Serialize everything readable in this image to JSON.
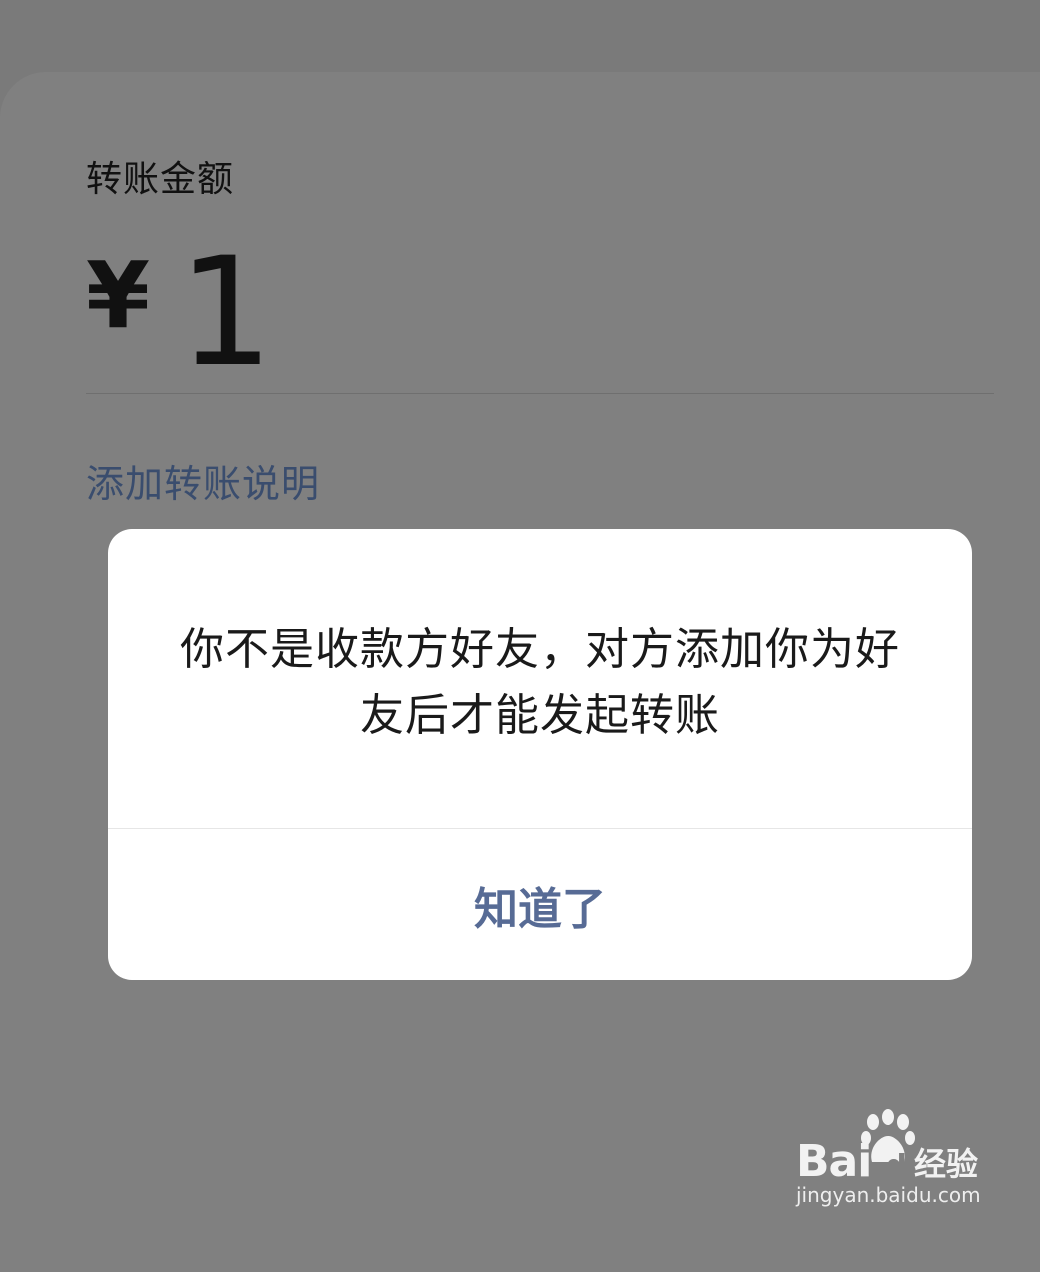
{
  "transfer": {
    "amount_label": "转账金额",
    "currency_symbol": "¥",
    "amount": "1",
    "add_note_link": "添加转账说明"
  },
  "dialog": {
    "message": "你不是收款方好友，对方添加你为好友后才能发起转账",
    "confirm_button": "知道了"
  },
  "watermark": {
    "brand": "Bai",
    "brand_suffix": "du",
    "label": "经验",
    "url": "jingyan.baidu.com"
  },
  "colors": {
    "overlay": "#808080",
    "link": "#576b95",
    "note_link": "#3a4d6e",
    "dialog_bg": "#ffffff"
  }
}
